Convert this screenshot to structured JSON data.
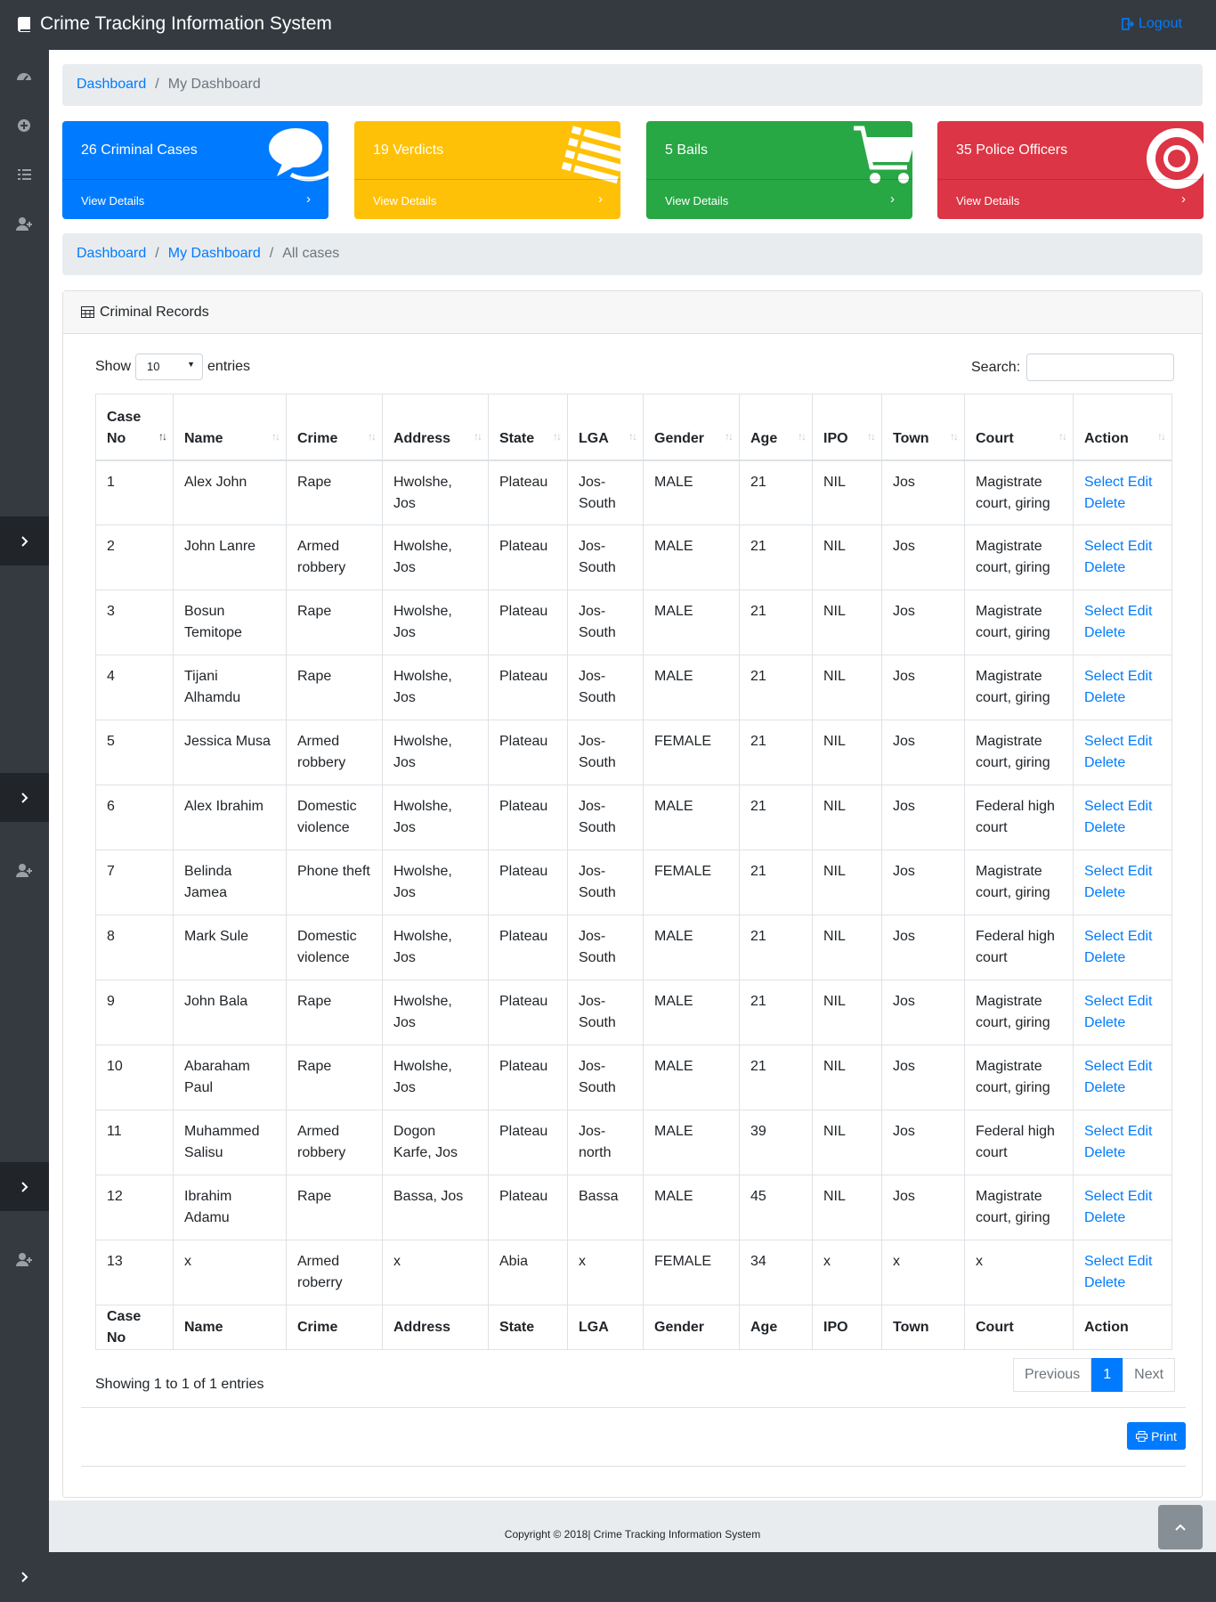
{
  "app": {
    "title": "Crime Tracking Information System",
    "logout_label": "Logout"
  },
  "breadcrumb_top": {
    "dashboard": "Dashboard",
    "current": "My Dashboard"
  },
  "cards": [
    {
      "label": "26 Criminal Cases",
      "footer": "View Details",
      "color": "#007bff",
      "icon": "comments-icon"
    },
    {
      "label": "19 Verdicts",
      "footer": "View Details",
      "color": "#ffc107",
      "icon": "list-icon"
    },
    {
      "label": "5 Bails",
      "footer": "View Details",
      "color": "#28a745",
      "icon": "shopping-cart-icon"
    },
    {
      "label": "35 Police Officers",
      "footer": "View Details",
      "color": "#dc3545",
      "icon": "life-ring-icon"
    }
  ],
  "breadcrumb_cases": {
    "dashboard": "Dashboard",
    "my_dashboard": "My Dashboard",
    "current": "All cases"
  },
  "panel": {
    "title": "Criminal Records"
  },
  "datatable": {
    "show_label": "Show",
    "entries_value": "10",
    "entries_label": "entries",
    "search_label": "Search:",
    "search_value": "",
    "columns": [
      "Case No",
      "Name",
      "Crime",
      "Address",
      "State",
      "LGA",
      "Gender",
      "Age",
      "IPO",
      "Town",
      "Court",
      "Action"
    ],
    "rows": [
      {
        "case_no": "1",
        "name": "Alex John",
        "crime": "Rape",
        "address": "Hwolshe, Jos",
        "state": "Plateau",
        "lga": "Jos-South",
        "gender": "MALE",
        "age": "21",
        "ipo": "NIL",
        "town": "Jos",
        "court": "Magistrate court, giring"
      },
      {
        "case_no": "2",
        "name": "John Lanre",
        "crime": "Armed robbery",
        "address": "Hwolshe, Jos",
        "state": "Plateau",
        "lga": "Jos-South",
        "gender": "MALE",
        "age": "21",
        "ipo": "NIL",
        "town": "Jos",
        "court": "Magistrate court, giring"
      },
      {
        "case_no": "3",
        "name": "Bosun Temitope",
        "crime": "Rape",
        "address": "Hwolshe, Jos",
        "state": "Plateau",
        "lga": "Jos-South",
        "gender": "MALE",
        "age": "21",
        "ipo": "NIL",
        "town": "Jos",
        "court": "Magistrate court, giring"
      },
      {
        "case_no": "4",
        "name": "Tijani Alhamdu",
        "crime": "Rape",
        "address": "Hwolshe, Jos",
        "state": "Plateau",
        "lga": "Jos-South",
        "gender": "MALE",
        "age": "21",
        "ipo": "NIL",
        "town": "Jos",
        "court": "Magistrate court, giring"
      },
      {
        "case_no": "5",
        "name": "Jessica Musa",
        "crime": "Armed robbery",
        "address": "Hwolshe, Jos",
        "state": "Plateau",
        "lga": "Jos-South",
        "gender": "FEMALE",
        "age": "21",
        "ipo": "NIL",
        "town": "Jos",
        "court": "Magistrate court, giring"
      },
      {
        "case_no": "6",
        "name": "Alex Ibrahim",
        "crime": "Domestic violence",
        "address": "Hwolshe, Jos",
        "state": "Plateau",
        "lga": "Jos-South",
        "gender": "MALE",
        "age": "21",
        "ipo": "NIL",
        "town": "Jos",
        "court": "Federal high court"
      },
      {
        "case_no": "7",
        "name": "Belinda Jamea",
        "crime": "Phone theft",
        "address": "Hwolshe, Jos",
        "state": "Plateau",
        "lga": "Jos-South",
        "gender": "FEMALE",
        "age": "21",
        "ipo": "NIL",
        "town": "Jos",
        "court": "Magistrate court, giring"
      },
      {
        "case_no": "8",
        "name": "Mark Sule",
        "crime": "Domestic violence",
        "address": "Hwolshe, Jos",
        "state": "Plateau",
        "lga": "Jos-South",
        "gender": "MALE",
        "age": "21",
        "ipo": "NIL",
        "town": "Jos",
        "court": "Federal high court"
      },
      {
        "case_no": "9",
        "name": "John Bala",
        "crime": "Rape",
        "address": "Hwolshe, Jos",
        "state": "Plateau",
        "lga": "Jos-South",
        "gender": "MALE",
        "age": "21",
        "ipo": "NIL",
        "town": "Jos",
        "court": "Magistrate court, giring"
      },
      {
        "case_no": "10",
        "name": "Abaraham Paul",
        "crime": "Rape",
        "address": "Hwolshe, Jos",
        "state": "Plateau",
        "lga": "Jos-South",
        "gender": "MALE",
        "age": "21",
        "ipo": "NIL",
        "town": "Jos",
        "court": "Magistrate court, giring"
      },
      {
        "case_no": "11",
        "name": "Muhammed Salisu",
        "crime": "Armed robbery",
        "address": "Dogon Karfe, Jos",
        "state": "Plateau",
        "lga": "Jos-north",
        "gender": "MALE",
        "age": "39",
        "ipo": "NIL",
        "town": "Jos",
        "court": "Federal high court"
      },
      {
        "case_no": "12",
        "name": "Ibrahim Adamu",
        "crime": "Rape",
        "address": "Bassa, Jos",
        "state": "Plateau",
        "lga": "Bassa",
        "gender": "MALE",
        "age": "45",
        "ipo": "NIL",
        "town": "Jos",
        "court": "Magistrate court, giring"
      },
      {
        "case_no": "13",
        "name": "x",
        "crime": "Armed roberry",
        "address": "x",
        "state": "Abia",
        "lga": "x",
        "gender": "FEMALE",
        "age": "34",
        "ipo": "x",
        "town": "x",
        "court": "x"
      }
    ],
    "action_select": "Select",
    "action_edit": "Edit",
    "action_delete": "Delete",
    "info": "Showing 1 to 1 of 1 entries",
    "pagination": {
      "previous": "Previous",
      "current": "1",
      "next": "Next"
    }
  },
  "print_label": "Print",
  "footer": {
    "copyright": "Copyright © 2018| Crime Tracking Information System"
  },
  "colors": {
    "navbar": "#343a40",
    "link": "#007bff",
    "breadcrumb_bg": "#e9ecef"
  }
}
